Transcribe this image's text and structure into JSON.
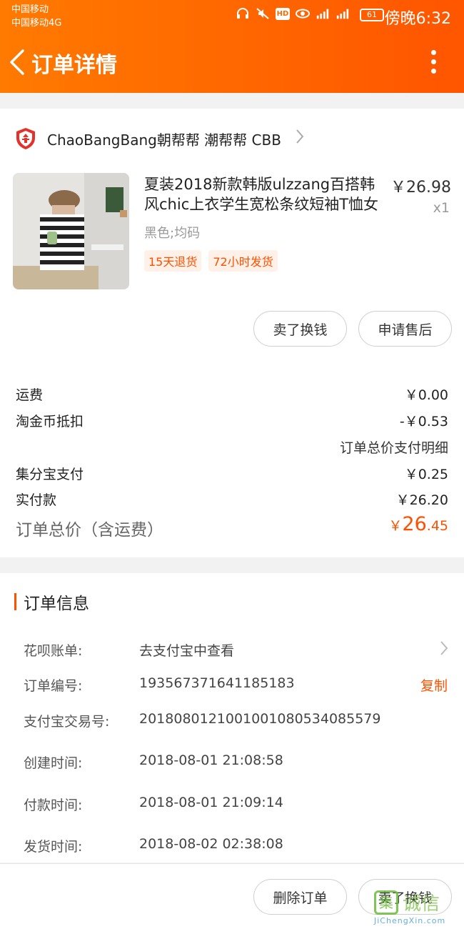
{
  "status_bar": {
    "carrier_1": "中国移动",
    "carrier_2": "中国移动4G",
    "battery": "61",
    "clock": "傍晚6:32"
  },
  "nav": {
    "title": "订单详情"
  },
  "shop": {
    "name": "ChaoBangBang朝帮帮 潮帮帮 CBB"
  },
  "product": {
    "title": "夏装2018新款韩版ulzzang百搭韩风chic上衣学生宽松条纹短袖T恤女",
    "price": "￥26.98",
    "qty": "x1",
    "spec": "黑色;均码",
    "tags": [
      "15天退货",
      "72小时发货"
    ]
  },
  "item_actions": {
    "sell_label": "卖了换钱",
    "after_sale_label": "申请售后"
  },
  "fees": {
    "shipping_label": "运费",
    "shipping_value": "￥0.00",
    "coin_label": "淘金币抵扣",
    "coin_value": "-￥0.53",
    "detail_link": "订单总价支付明细",
    "jifenbao_label": "集分宝支付",
    "jifenbao_value": "￥0.25",
    "paid_label": "实付款",
    "paid_value": "￥26.20",
    "total_label": "订单总价（含运费）",
    "total_currency": "￥",
    "total_int": "26",
    "total_dec": ".45"
  },
  "order_info": {
    "section_title": "订单信息",
    "huabei_label": "花呗账单:",
    "huabei_value": "去支付宝中查看",
    "order_no_label": "订单编号:",
    "order_no_value": "193567371641185183",
    "copy_label": "复制",
    "alipay_label": "支付宝交易号:",
    "alipay_value": "2018080121001001080534085579",
    "created_label": "创建时间:",
    "created_value": "2018-08-01 21:08:58",
    "paid_label": "付款时间:",
    "paid_value": "2018-08-01 21:09:14",
    "shipped_label": "发货时间:",
    "shipped_value": "2018-08-02 02:38:08"
  },
  "bottom_actions": {
    "delete_label": "删除订单",
    "sell_label": "卖了换钱"
  },
  "watermark": {
    "cn": "诚信",
    "en": "JiChengXin.com"
  },
  "colors": {
    "accent": "#ff5000",
    "header_start": "#ff7a00",
    "header_end": "#ff5500"
  }
}
